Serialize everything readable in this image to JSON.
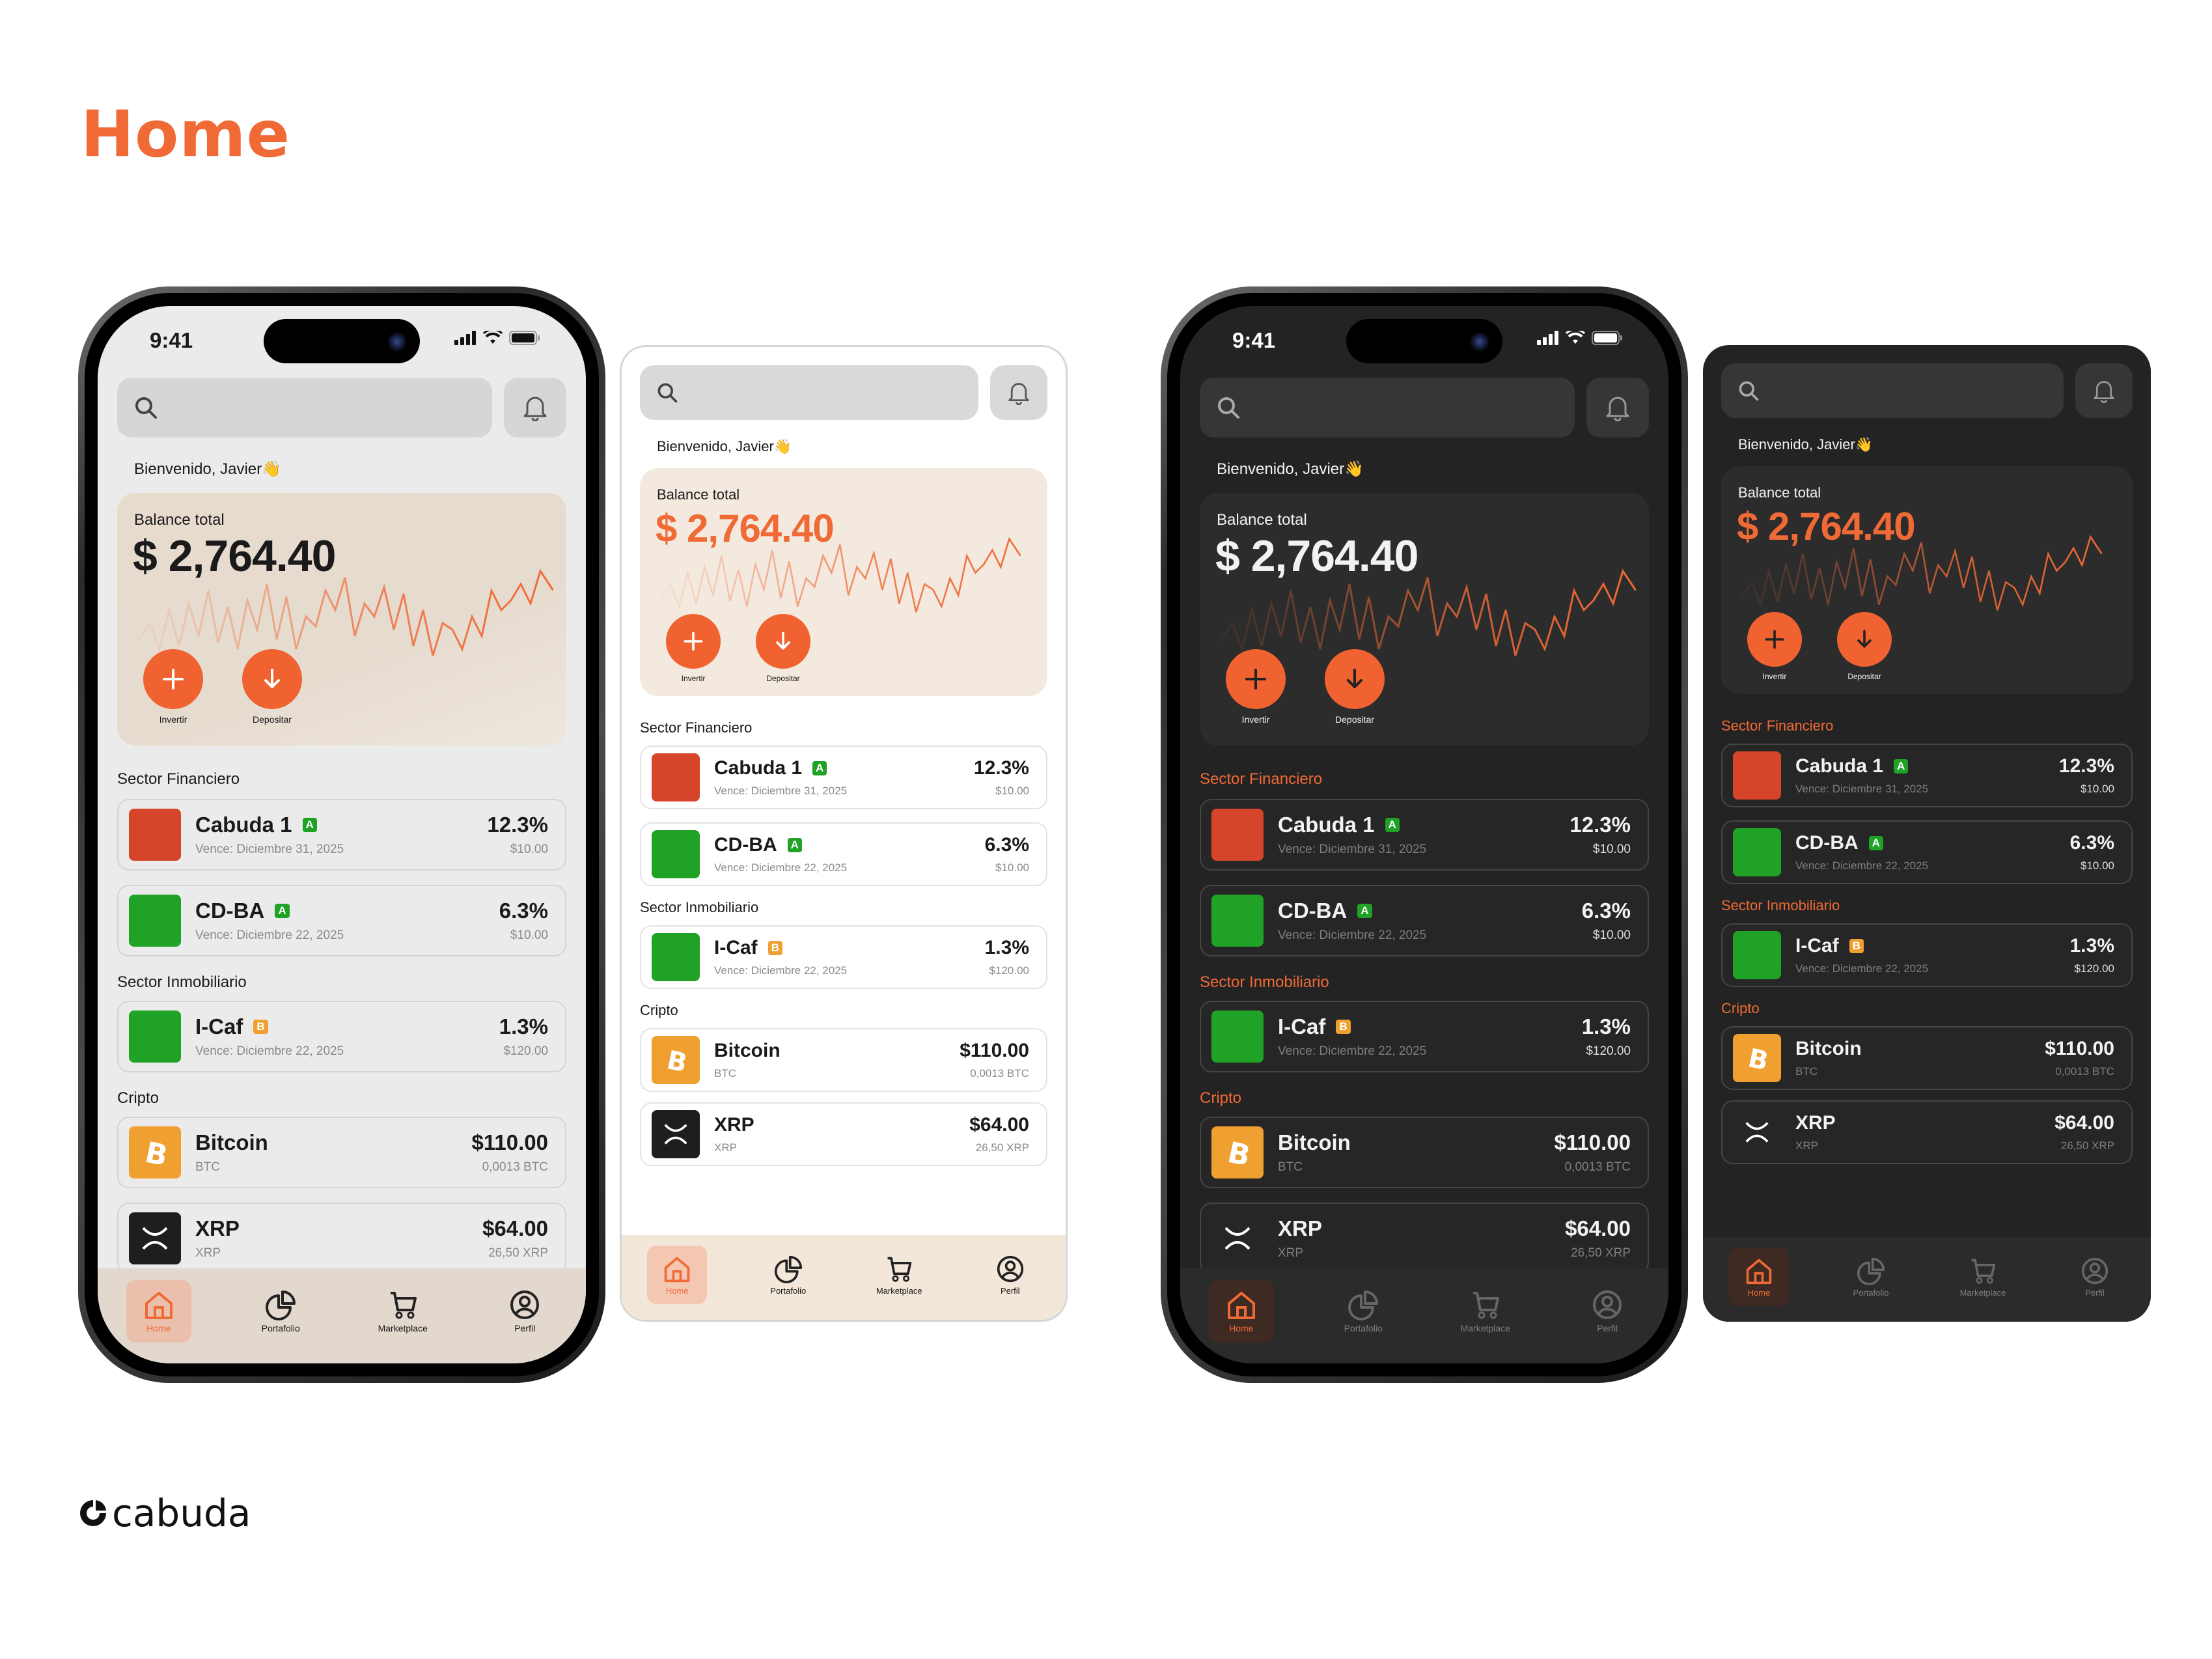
{
  "page": {
    "title": "Home",
    "logo_text": "cabuda"
  },
  "colors": {
    "accent": "#f06a36",
    "green": "#1fa225",
    "red": "#d6452a",
    "badge_a": "#1fa225",
    "badge_b": "#f0a030",
    "bitcoin": "#f0a030",
    "xrp": "#1e1e1e"
  },
  "status": {
    "time": "9:41"
  },
  "header": {
    "search_icon": "search-icon",
    "bell_icon": "bell-icon"
  },
  "welcome": "Bienvenido, Javier👋",
  "balance": {
    "label": "Balance total",
    "amount": "$ 2,764.40"
  },
  "actions": [
    {
      "label": "Invertir",
      "icon": "plus-icon"
    },
    {
      "label": "Depositar",
      "icon": "arrow-down-icon"
    }
  ],
  "sections": {
    "financiero": "Sector Financiero",
    "inmobiliario": "Sector Inmobiliario",
    "cripto": "Cripto"
  },
  "assets": {
    "cabuda": {
      "name": "Cabuda 1",
      "badge": "A",
      "sub": "Vence: Diciembre 31, 2025",
      "value": "12.3%",
      "small": "$10.00"
    },
    "cdba": {
      "name": "CD-BA",
      "badge": "A",
      "sub": "Vence: Diciembre 22, 2025",
      "value": "6.3%",
      "small": "$10.00"
    },
    "icaf": {
      "name": "I-Caf",
      "badge": "B",
      "sub": "Vence: Diciembre 22, 2025",
      "value": "1.3%",
      "small": "$120.00"
    },
    "bitcoin": {
      "name": "Bitcoin",
      "sub": "BTC",
      "value": "$110.00",
      "small": "0,0013 BTC"
    },
    "xrp": {
      "name": "XRP",
      "sub": "XRP",
      "value": "$64.00",
      "small": "26,50 XRP"
    }
  },
  "tabs": [
    {
      "label": "Home",
      "icon": "home-icon",
      "active": true
    },
    {
      "label": "Portafolio",
      "icon": "pie-chart-icon",
      "active": false
    },
    {
      "label": "Marketplace",
      "icon": "cart-icon",
      "active": false
    },
    {
      "label": "Perfil",
      "icon": "user-icon",
      "active": false
    }
  ]
}
